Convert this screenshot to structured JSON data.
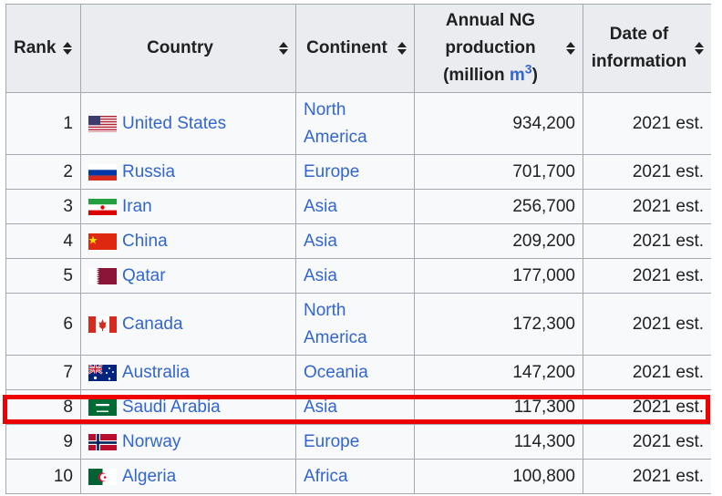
{
  "headers": {
    "rank": "Rank",
    "country": "Country",
    "continent": "Continent",
    "production_line1": "Annual NG",
    "production_line2": "production",
    "production_line3_pre": "(million ",
    "production_unit": "m",
    "production_sup": "3",
    "production_line3_post": ")",
    "date_line1": "Date of",
    "date_line2": "information"
  },
  "rows": [
    {
      "rank": "1",
      "country": "United States",
      "continent_line1": "North",
      "continent_line2": "America",
      "production": "934,200",
      "date": "2021 est.",
      "flag_icon": "us-flag-icon"
    },
    {
      "rank": "2",
      "country": "Russia",
      "continent_line1": "Europe",
      "continent_line2": "",
      "production": "701,700",
      "date": "2021 est.",
      "flag_icon": "russia-flag-icon"
    },
    {
      "rank": "3",
      "country": "Iran",
      "continent_line1": "Asia",
      "continent_line2": "",
      "production": "256,700",
      "date": "2021 est.",
      "flag_icon": "iran-flag-icon"
    },
    {
      "rank": "4",
      "country": "China",
      "continent_line1": "Asia",
      "continent_line2": "",
      "production": "209,200",
      "date": "2021 est.",
      "flag_icon": "china-flag-icon"
    },
    {
      "rank": "5",
      "country": "Qatar",
      "continent_line1": "Asia",
      "continent_line2": "",
      "production": "177,000",
      "date": "2021 est.",
      "flag_icon": "qatar-flag-icon"
    },
    {
      "rank": "6",
      "country": "Canada",
      "continent_line1": "North",
      "continent_line2": "America",
      "production": "172,300",
      "date": "2021 est.",
      "flag_icon": "canada-flag-icon"
    },
    {
      "rank": "7",
      "country": "Australia",
      "continent_line1": "Oceania",
      "continent_line2": "",
      "production": "147,200",
      "date": "2021 est.",
      "flag_icon": "australia-flag-icon"
    },
    {
      "rank": "8",
      "country": "Saudi Arabia",
      "continent_line1": "Asia",
      "continent_line2": "",
      "production": "117,300",
      "date": "2021 est.",
      "flag_icon": "saudi-arabia-flag-icon"
    },
    {
      "rank": "9",
      "country": "Norway",
      "continent_line1": "Europe",
      "continent_line2": "",
      "production": "114,300",
      "date": "2021 est.",
      "flag_icon": "norway-flag-icon"
    },
    {
      "rank": "10",
      "country": "Algeria",
      "continent_line1": "Africa",
      "continent_line2": "",
      "production": "100,800",
      "date": "2021 est.",
      "flag_icon": "algeria-flag-icon"
    }
  ],
  "highlighted_row_rank": "8",
  "colors": {
    "link": "#3366cc",
    "header_bg": "#eaecf0",
    "cell_bg": "#f8f9fa",
    "border": "#a2a9b1",
    "highlight": "#ee0000"
  }
}
